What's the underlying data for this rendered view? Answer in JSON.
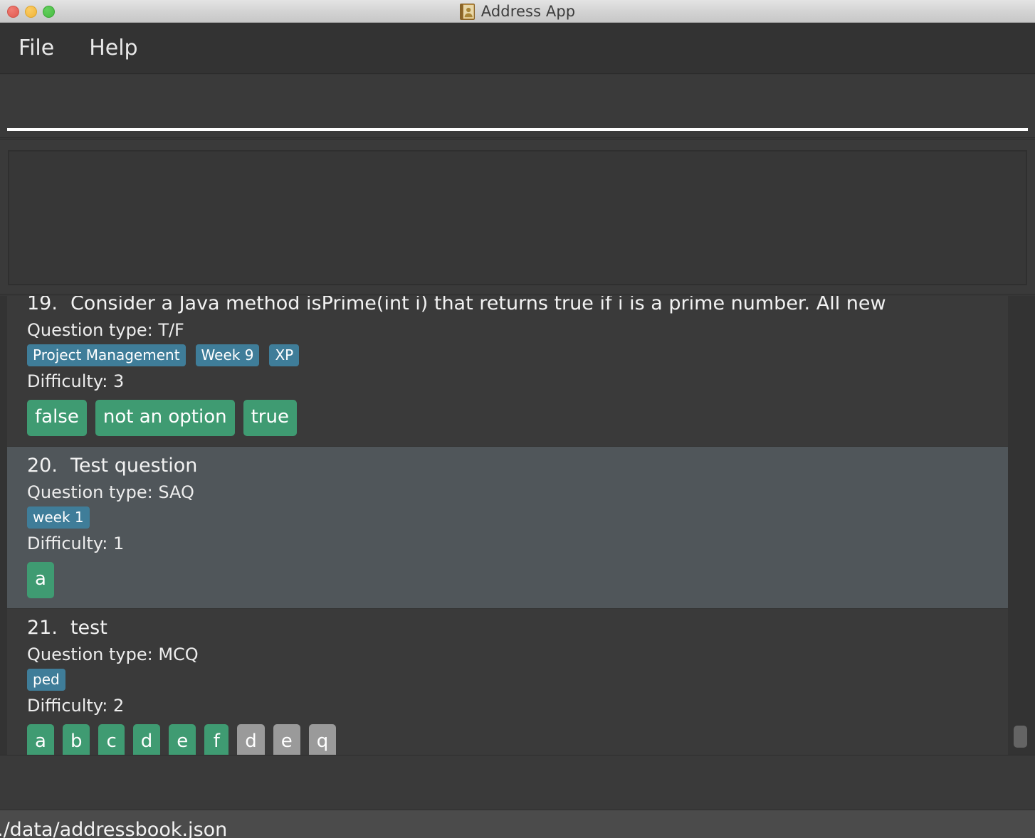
{
  "window": {
    "title": "Address App",
    "icon": "address-book-icon",
    "controls": {
      "close": "close",
      "minimize": "minimize",
      "maximize": "maximize"
    }
  },
  "menubar": {
    "items": [
      {
        "label": "File"
      },
      {
        "label": "Help"
      }
    ]
  },
  "search_panel": {
    "value": "",
    "placeholder": ""
  },
  "result_box": {
    "content": ""
  },
  "colors": {
    "tag": "#3f7d99",
    "chip": "#3f9b72",
    "chip_muted": "#9a9a9a",
    "selected_row": "#50565a",
    "row": "#3a3a3a",
    "window_bg": "#373737",
    "statusbar": "#4b4b4b",
    "field_underline": "#ffffff"
  },
  "question_list": {
    "labels": {
      "type_prefix": "Question type:",
      "difficulty_prefix": "Difficulty:"
    },
    "items": [
      {
        "number": "19.",
        "title": "Consider a Java method isPrime(int i) that returns true if i is a prime number. All new",
        "clipped": true,
        "selected": false,
        "question_type": "T/F",
        "tags": [
          "Project Management",
          "Week 9",
          "XP"
        ],
        "difficulty": "3",
        "answers": [
          {
            "text": "false",
            "muted": false
          },
          {
            "text": "not an option",
            "muted": false
          },
          {
            "text": "true",
            "muted": false
          }
        ]
      },
      {
        "number": "20.",
        "title": "Test question",
        "clipped": false,
        "selected": true,
        "question_type": "SAQ",
        "tags": [
          "week 1"
        ],
        "difficulty": "1",
        "answers": [
          {
            "text": "a",
            "muted": false
          }
        ]
      },
      {
        "number": "21.",
        "title": "test",
        "clipped": false,
        "selected": false,
        "question_type": "MCQ",
        "tags": [
          "ped"
        ],
        "difficulty": "2",
        "answers": [
          {
            "text": "a",
            "muted": false
          },
          {
            "text": "b",
            "muted": false
          },
          {
            "text": "c",
            "muted": false
          },
          {
            "text": "d",
            "muted": false
          },
          {
            "text": "e",
            "muted": false
          },
          {
            "text": "f",
            "muted": false
          },
          {
            "text": "d",
            "muted": true
          },
          {
            "text": "e",
            "muted": true
          },
          {
            "text": "q",
            "muted": true
          }
        ]
      }
    ]
  },
  "statusbar": {
    "path": "./data/addressbook.json"
  }
}
